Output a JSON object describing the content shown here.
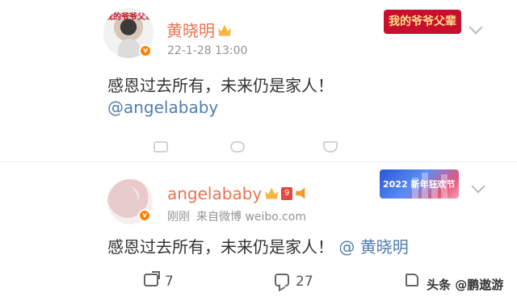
{
  "post1": {
    "username": "黄晓明",
    "timestamp": "22-1-28 13:00",
    "text": "感恩过去所有，未来仍是家人！",
    "mention": "@angelababy",
    "banner_text": "我的爷爷父辈",
    "avatar_text": "我的爷爷父辈",
    "badge_letter": "v"
  },
  "post2": {
    "username": "angelababy",
    "time": "刚刚",
    "source": "来自微博 weibo.com",
    "text": "感恩过去所有，未来仍是家人！",
    "mention": "@ 黄晓明",
    "banner_text": "2022 新年狂欢节",
    "rank_badge": "9",
    "badge_letter": "v"
  },
  "actions": {
    "share_count": "7",
    "comment_count": "27",
    "like_count": ""
  },
  "watermark": "头条 @鹏遨游",
  "colors": {
    "username": "#eb7350",
    "mention": "#507daf",
    "verified_badge": "#ff8200",
    "meta": "#939393"
  },
  "icons": {
    "crown": "crown-icon",
    "chevron": "chevron-down-icon",
    "share": "share-icon",
    "comment": "comment-icon",
    "like": "like-icon"
  }
}
